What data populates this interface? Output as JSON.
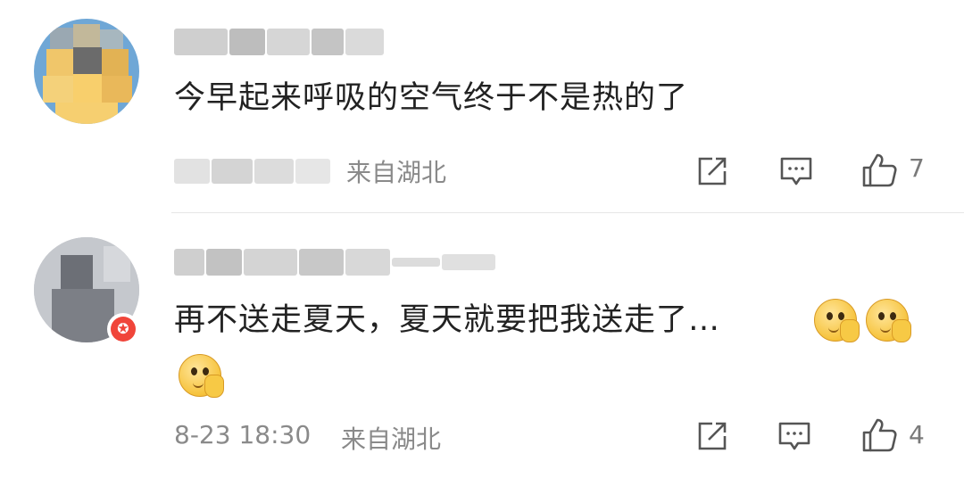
{
  "comments": [
    {
      "text": "今早起来呼吸的空气终于不是热的了",
      "location": "来自湖北",
      "likes": "7",
      "icons": [
        "repost-icon",
        "comment-icon",
        "like-icon"
      ]
    },
    {
      "text": "再不送走夏天，夏天就要把我送走了…",
      "time": "8-23 18:30",
      "location": "来自湖北",
      "likes": "4",
      "emoji": "smirk-hand-emoji",
      "icons": [
        "repost-icon",
        "comment-icon",
        "like-icon"
      ]
    }
  ]
}
